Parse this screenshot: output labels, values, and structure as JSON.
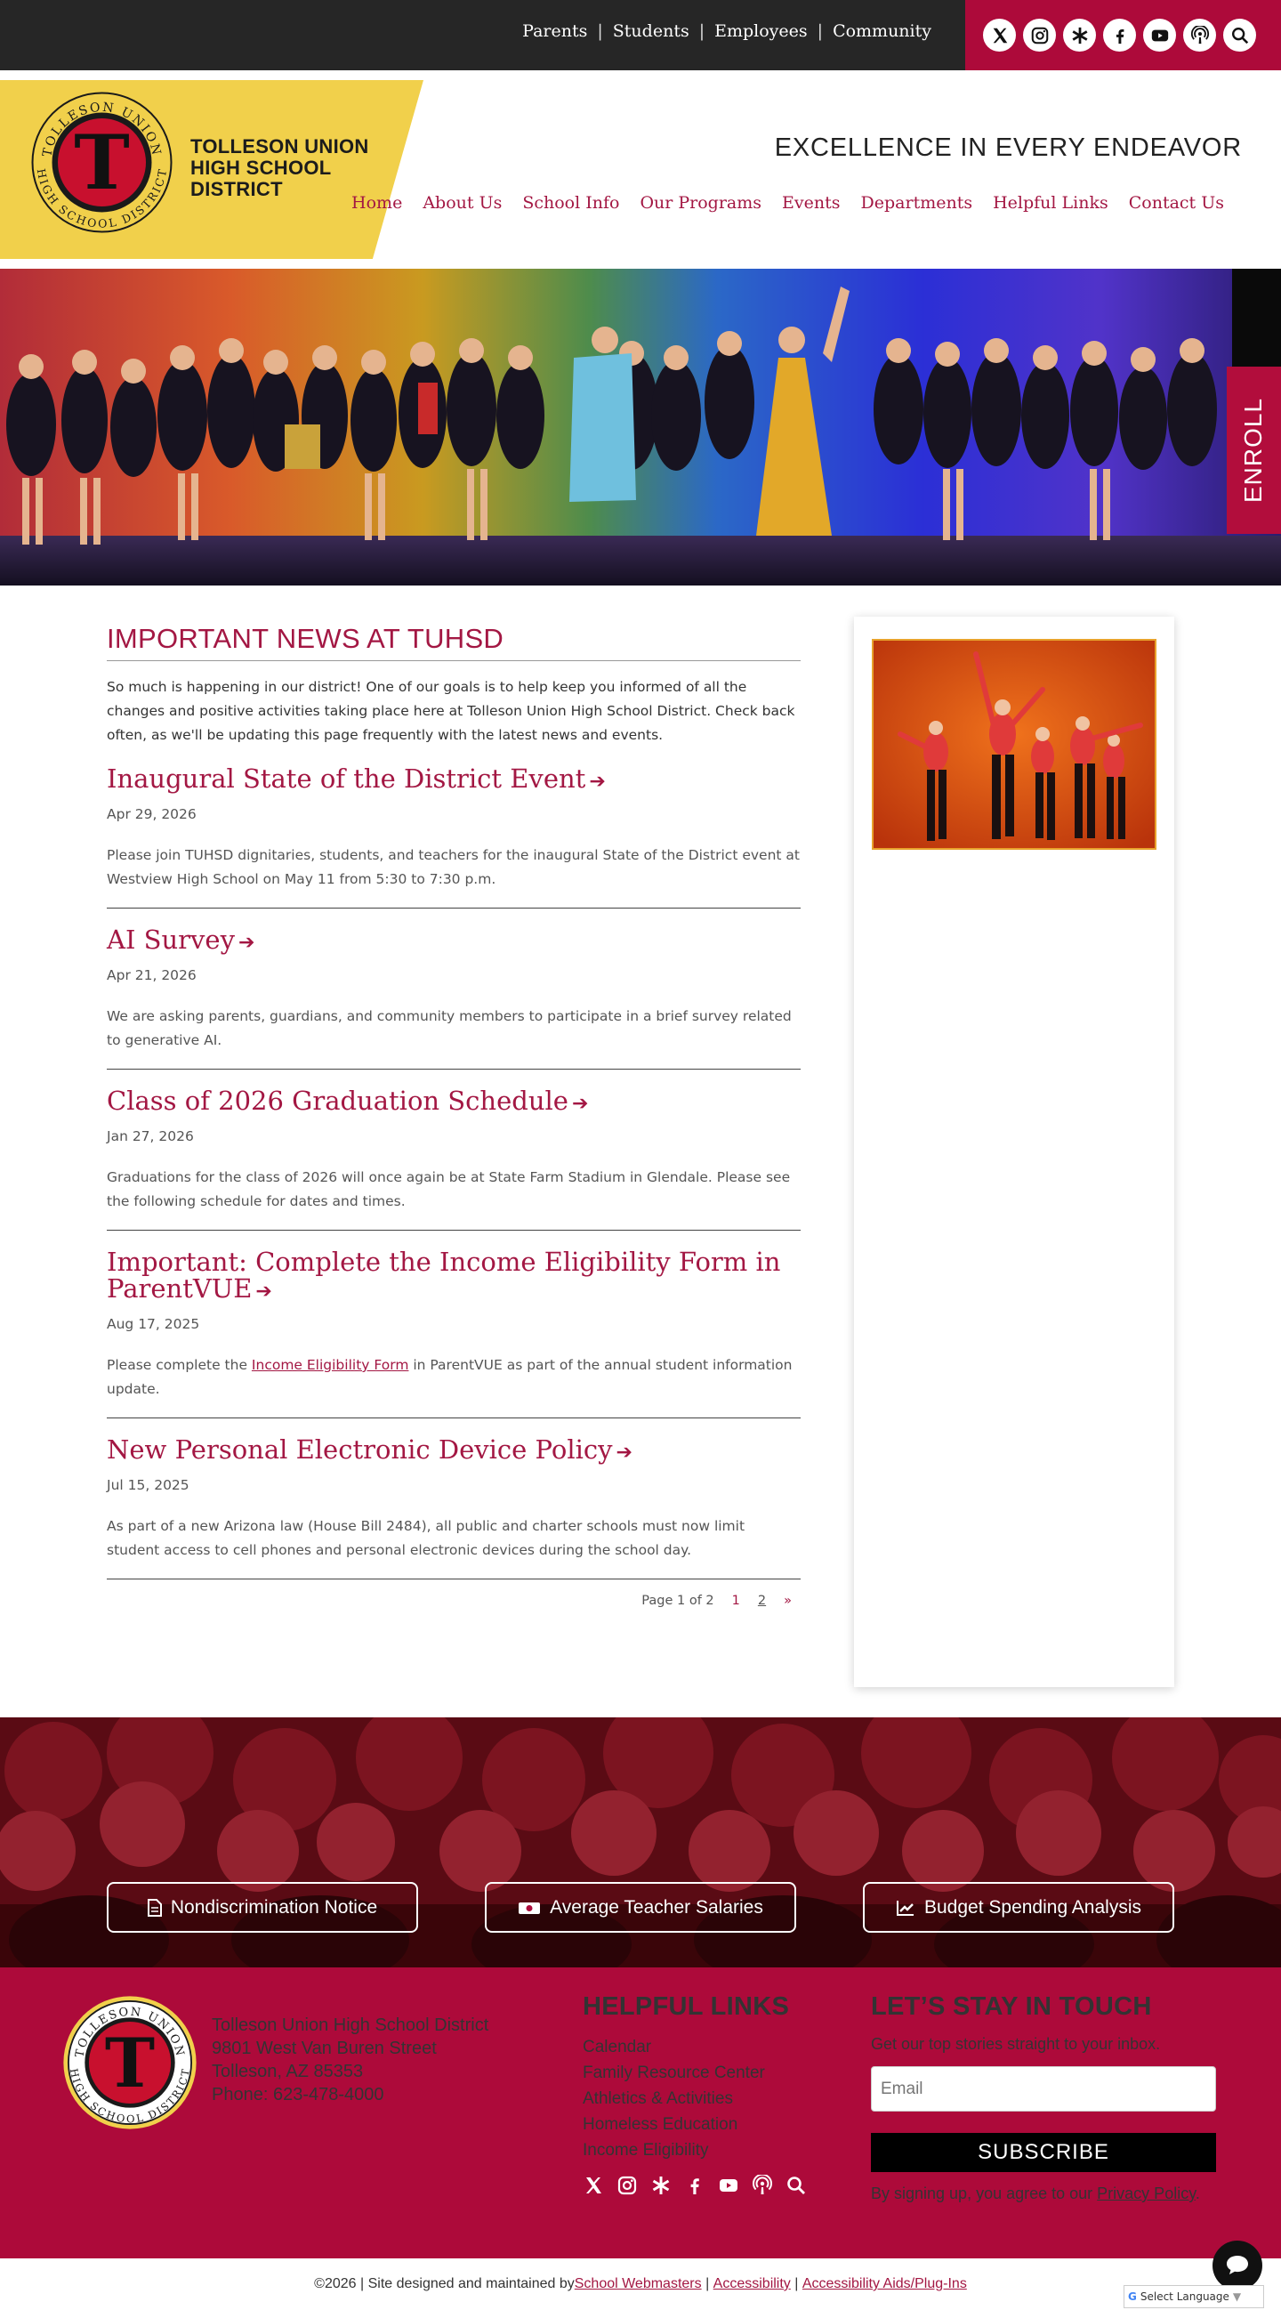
{
  "topbar": {
    "links": [
      "Parents",
      "Students",
      "Employees",
      "Community"
    ],
    "social": [
      "x-icon",
      "instagram-icon",
      "linktree-icon",
      "facebook-icon",
      "youtube-icon",
      "podcast-icon",
      "search-icon"
    ]
  },
  "header": {
    "district_line1": "TOLLESON UNION",
    "district_line2": "HIGH SCHOOL",
    "district_line3": "DISTRICT",
    "seal_text_top": "TOLLESON UNION",
    "seal_text_bottom": "HIGH SCHOOL DISTRICT",
    "seal_letter": "T",
    "motto": "EXCELLENCE IN EVERY ENDEAVOR",
    "nav": [
      "Home",
      "About Us",
      "School Info",
      "Our Programs",
      "Events",
      "Departments",
      "Helpful Links",
      "Contact Us"
    ]
  },
  "enroll_label": "ENROLL",
  "news": {
    "heading": "IMPORTANT NEWS AT TUHSD",
    "intro": "So much is happening in our district! One of our goals is to help keep you informed of all the changes and positive activities taking place here at Tolleson Union High School District. Check back often, as we'll be updating this page frequently with the latest news and events.",
    "articles": [
      {
        "title": "Inaugural State of the District Event",
        "date": "Apr 29, 2026",
        "summary": "Please join TUHSD dignitaries, students, and teachers for the inaugural State of the District event at Westview High School on May 11 from 5:30 to 7:30 p.m."
      },
      {
        "title": "AI Survey",
        "date": "Apr 21, 2026",
        "summary": "We are asking parents, guardians, and community members to participate in a brief survey related to generative AI."
      },
      {
        "title": "Class of 2026 Graduation Schedule",
        "date": "Jan 27, 2026",
        "summary": "Graduations for the class of 2026 will once again be at State Farm Stadium in Glendale. Please see the following schedule for dates and times."
      },
      {
        "title": "Important: Complete the Income Eligibility Form in ParentVUE",
        "date": "Aug 17, 2025",
        "summary_pre": "Please complete the ",
        "summary_link": "Income Eligibility Form",
        "summary_post": " in ParentVUE as part of the annual student information update."
      },
      {
        "title": "New Personal Electronic Device Policy",
        "date": "Jul 15, 2025",
        "summary": "As part of a new Arizona law (House Bill 2484), all public and charter schools must now limit student access to cell phones and personal electronic devices during the school day."
      }
    ],
    "pager": {
      "label": "Page 1 of 2",
      "p1": "1",
      "p2": "2",
      "next": "»"
    }
  },
  "banner_buttons": [
    {
      "label": "Nondiscrimination Notice",
      "icon": "document-icon"
    },
    {
      "label": "Average Teacher Salaries",
      "icon": "money-icon"
    },
    {
      "label": "Budget Spending Analysis",
      "icon": "chart-icon"
    }
  ],
  "footer": {
    "address": [
      "Tolleson Union High School District",
      "9801 West Van Buren Street",
      "Tolleson, AZ 85353",
      "Phone: 623-478-4000"
    ],
    "helpful_heading": "HELPFUL LINKS",
    "helpful_links": [
      "Calendar",
      "Family Resource Center",
      "Athletics & Activities",
      "Homeless Education",
      "Income Eligibility"
    ],
    "stay_heading": "LET’S STAY IN TOUCH",
    "tagline": "Get our top stories straight to your inbox.",
    "email_placeholder": "Email",
    "subscribe": "SUBSCRIBE",
    "agree_pre": "By signing up, you agree to our ",
    "agree_link": "Privacy Policy",
    "agree_post": "."
  },
  "copyright": {
    "pre": "©2026 | Site designed and maintained by ",
    "link1": "School Webmasters",
    "sep": " | ",
    "link2": "Accessibility",
    "link3": "Accessibility Aids/Plug-Ins"
  },
  "translate_label": "Select Language",
  "colors": {
    "brand": "#ad0a3a",
    "accent_yellow": "#f1d04b",
    "link": "#a31743"
  }
}
